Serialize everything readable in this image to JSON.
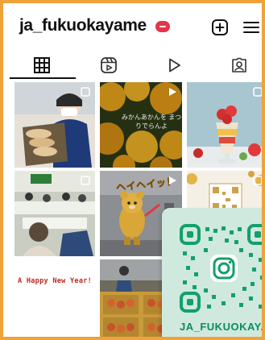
{
  "header": {
    "username": "ja_fukuokayame",
    "icons": [
      "verified-badge",
      "add-post-icon",
      "menu-icon"
    ]
  },
  "tabs": [
    {
      "name": "grid",
      "icon": "grid-icon",
      "selected": true
    },
    {
      "name": "reels",
      "icon": "reels-icon",
      "selected": false
    },
    {
      "name": "videos",
      "icon": "play-icon",
      "selected": false
    },
    {
      "name": "tagged",
      "icon": "tagged-icon",
      "selected": false
    }
  ],
  "posts": {
    "mikan_caption": "みかんあかんを まつりでらんよ",
    "heyhey_text": "ヘイヘイッ！",
    "newyear_text": "A Happy New Year!"
  },
  "qr_card": {
    "caption": "JA_FUKUOKAYAME"
  },
  "colors": {
    "frame": "#f0a23a",
    "badge": "#e5344b",
    "qr_green": "#0f8a5f",
    "qr_background": "#cfe9df"
  }
}
